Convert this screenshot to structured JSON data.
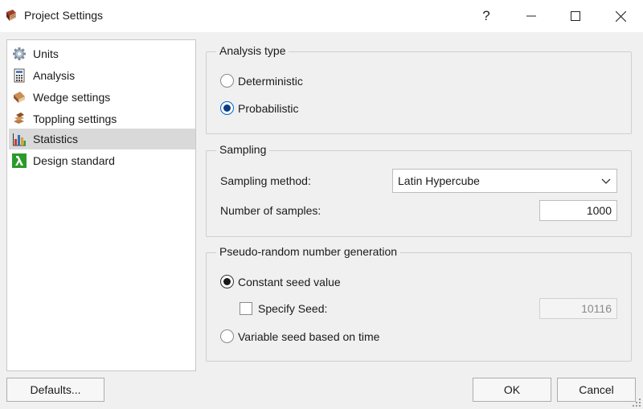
{
  "window": {
    "title": "Project Settings",
    "help_glyph": "?",
    "icons": [
      "app-book-icon",
      "minimize-icon",
      "maximize-icon",
      "close-icon"
    ]
  },
  "nav": {
    "items": [
      {
        "label": "Units",
        "icon": "gear-icon"
      },
      {
        "label": "Analysis",
        "icon": "calculator-icon"
      },
      {
        "label": "Wedge settings",
        "icon": "wedge-icon"
      },
      {
        "label": "Toppling settings",
        "icon": "toppling-icon"
      },
      {
        "label": "Statistics",
        "icon": "bar-chart-icon"
      },
      {
        "label": "Design standard",
        "icon": "lambda-icon"
      }
    ],
    "selected": "Statistics"
  },
  "analysis_type": {
    "title": "Analysis type",
    "options": [
      {
        "label": "Deterministic",
        "checked": false
      },
      {
        "label": "Probabilistic",
        "checked": true
      }
    ]
  },
  "sampling": {
    "title": "Sampling",
    "method_label": "Sampling method:",
    "method_value": "Latin Hypercube",
    "samples_label": "Number of samples:",
    "samples_value": "1000"
  },
  "prng": {
    "title": "Pseudo-random number generation",
    "constant_label": "Constant seed value",
    "constant_checked": true,
    "specify_label": "Specify Seed:",
    "specify_checked": false,
    "seed_value": "10116",
    "variable_label": "Variable seed based on time",
    "variable_checked": false
  },
  "buttons": {
    "defaults": "Defaults...",
    "ok": "OK",
    "cancel": "Cancel"
  },
  "colors": {
    "window_bg": "#f0f0f0",
    "selection_bg": "#d9d9d9",
    "focus_blue": "#0066cc"
  }
}
